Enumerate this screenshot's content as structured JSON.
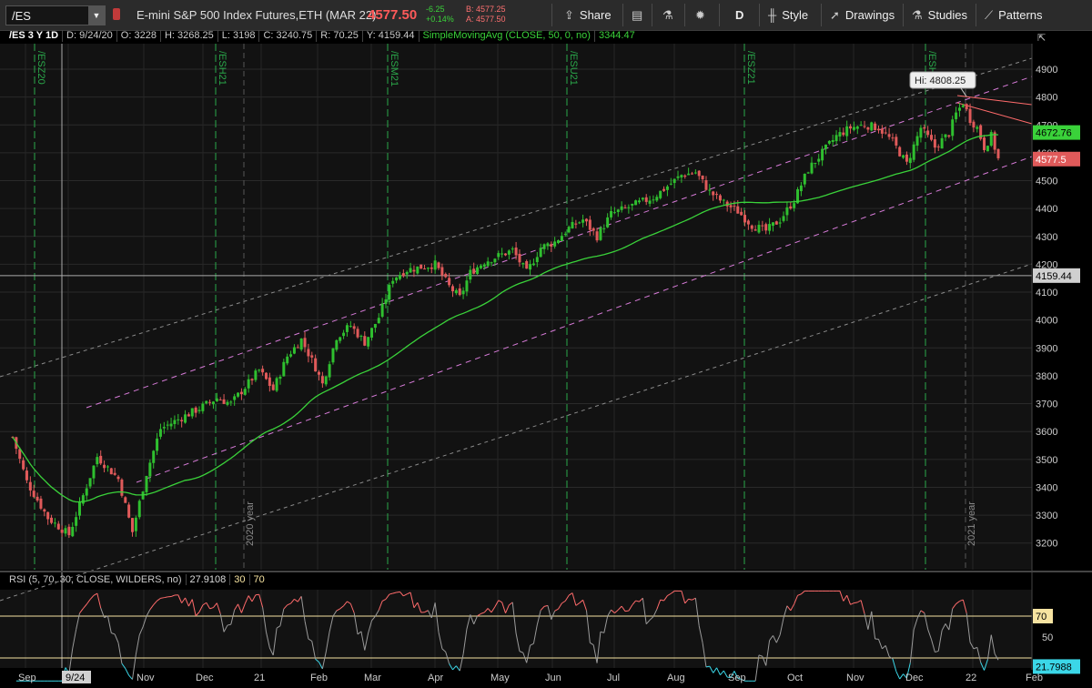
{
  "toolbar": {
    "symbol": "/ES",
    "description": "E-mini S&P 500 Index Futures,ETH (MAR 22)",
    "last": "4577.50",
    "change": "-6.25",
    "change_pct": "+0.14%",
    "bid": "B: 4577.25",
    "ask": "A: 4577.50",
    "share": "Share",
    "period": "D",
    "style": "Style",
    "drawings": "Drawings",
    "studies": "Studies",
    "patterns": "Patterns"
  },
  "info": {
    "symbol_period": "/ES 3 Y 1D",
    "date": "D: 9/24/20",
    "open": "O: 3228",
    "high": "H: 3268.25",
    "low": "L: 3198",
    "close": "C: 3240.75",
    "range": "R: 70.25",
    "y": "Y: 4159.44",
    "sma_label": "SimpleMovingAvg (CLOSE, 50, 0, no)",
    "sma_value": "3344.47"
  },
  "rsi_header": {
    "label": "RSI (5, 70, 30, CLOSE, WILDERS, no)",
    "value": "27.9108",
    "lower": "30",
    "upper": "70"
  },
  "price_tags": {
    "sma": "4672.76",
    "last": "4577.5",
    "crosshair": "4159.44",
    "high_label": "Hi: 4808.25",
    "rsi_upper": "70",
    "rsi_value": "21.7988"
  },
  "colors": {
    "up": "#2fbf2f",
    "down": "#e05a5a",
    "sma": "#3ad23a",
    "channel": "#d77bd8",
    "outer_channel": "#8a8a8a",
    "resistance": "#ff6b6b",
    "rsi_line": "#9a9a9a",
    "rsi_overbought": "#ff6b6b",
    "rsi_oversold": "#3bd7e8",
    "rsi_level": "#f6e3a1"
  },
  "chart_data": [
    {
      "type": "candlestick",
      "title": "/ES 3 Y 1D",
      "y_ticks": [
        3200,
        3300,
        3400,
        3500,
        3600,
        3700,
        3800,
        3900,
        4000,
        4100,
        4200,
        4300,
        4400,
        4500,
        4600,
        4700,
        4800,
        4900
      ],
      "ylim": [
        3155,
        4965
      ],
      "x_labels": [
        "Sep",
        "Oct",
        "Nov",
        "Dec",
        "21",
        "Feb",
        "Mar",
        "Apr",
        "May",
        "Jun",
        "Jul",
        "Aug",
        "Sep",
        "Oct",
        "Nov",
        "Dec",
        "22",
        "Feb"
      ],
      "x_highlight": "9/24",
      "expirations": [
        "/ESZ20",
        "/ESH21",
        "/ESM21",
        "/ESU21",
        "/ESZ21",
        "/ESH22"
      ],
      "year_markers": [
        "2020 year",
        "2021 year"
      ],
      "series": [
        {
          "name": "Close",
          "anchors": [
            [
              0,
              3580
            ],
            [
              4,
              3420
            ],
            [
              10,
              3290
            ],
            [
              16,
              3230
            ],
            [
              20,
              3370
            ],
            [
              24,
              3510
            ],
            [
              30,
              3430
            ],
            [
              34,
              3240
            ],
            [
              38,
              3450
            ],
            [
              42,
              3610
            ],
            [
              48,
              3650
            ],
            [
              54,
              3690
            ],
            [
              58,
              3720
            ],
            [
              62,
              3700
            ],
            [
              66,
              3760
            ],
            [
              70,
              3820
            ],
            [
              74,
              3750
            ],
            [
              78,
              3870
            ],
            [
              82,
              3930
            ],
            [
              86,
              3830
            ],
            [
              88,
              3770
            ],
            [
              92,
              3940
            ],
            [
              96,
              3980
            ],
            [
              100,
              3920
            ],
            [
              104,
              4010
            ],
            [
              108,
              4150
            ],
            [
              112,
              4180
            ],
            [
              116,
              4190
            ],
            [
              120,
              4200
            ],
            [
              124,
              4120
            ],
            [
              127,
              4080
            ],
            [
              130,
              4170
            ],
            [
              134,
              4210
            ],
            [
              138,
              4230
            ],
            [
              142,
              4250
            ],
            [
              146,
              4170
            ],
            [
              150,
              4260
            ],
            [
              154,
              4280
            ],
            [
              158,
              4330
            ],
            [
              162,
              4360
            ],
            [
              166,
              4300
            ],
            [
              170,
              4380
            ],
            [
              174,
              4400
            ],
            [
              178,
              4420
            ],
            [
              182,
              4440
            ],
            [
              186,
              4480
            ],
            [
              190,
              4520
            ],
            [
              194,
              4530
            ],
            [
              198,
              4460
            ],
            [
              202,
              4420
            ],
            [
              206,
              4390
            ],
            [
              210,
              4340
            ],
            [
              214,
              4320
            ],
            [
              218,
              4360
            ],
            [
              222,
              4430
            ],
            [
              226,
              4540
            ],
            [
              230,
              4600
            ],
            [
              234,
              4660
            ],
            [
              238,
              4690
            ],
            [
              242,
              4700
            ],
            [
              246,
              4690
            ],
            [
              250,
              4640
            ],
            [
              254,
              4560
            ],
            [
              258,
              4690
            ],
            [
              262,
              4620
            ],
            [
              266,
              4670
            ],
            [
              268,
              4740
            ],
            [
              270,
              4780
            ],
            [
              272,
              4720
            ],
            [
              274,
              4690
            ],
            [
              276,
              4620
            ],
            [
              278,
              4660
            ],
            [
              280,
              4577
            ]
          ]
        },
        {
          "name": "SimpleMovingAvg (CLOSE, 50, 0, no)",
          "last_value": 4672.76
        },
        {
          "name": "Hi",
          "value": 4808.25
        }
      ]
    },
    {
      "type": "line",
      "title": "RSI (5, 70, 30, CLOSE, WILDERS, no)",
      "y_ticks": [
        50
      ],
      "levels": [
        30,
        70
      ],
      "ylim": [
        0,
        100
      ],
      "last_value": 21.7988
    }
  ]
}
